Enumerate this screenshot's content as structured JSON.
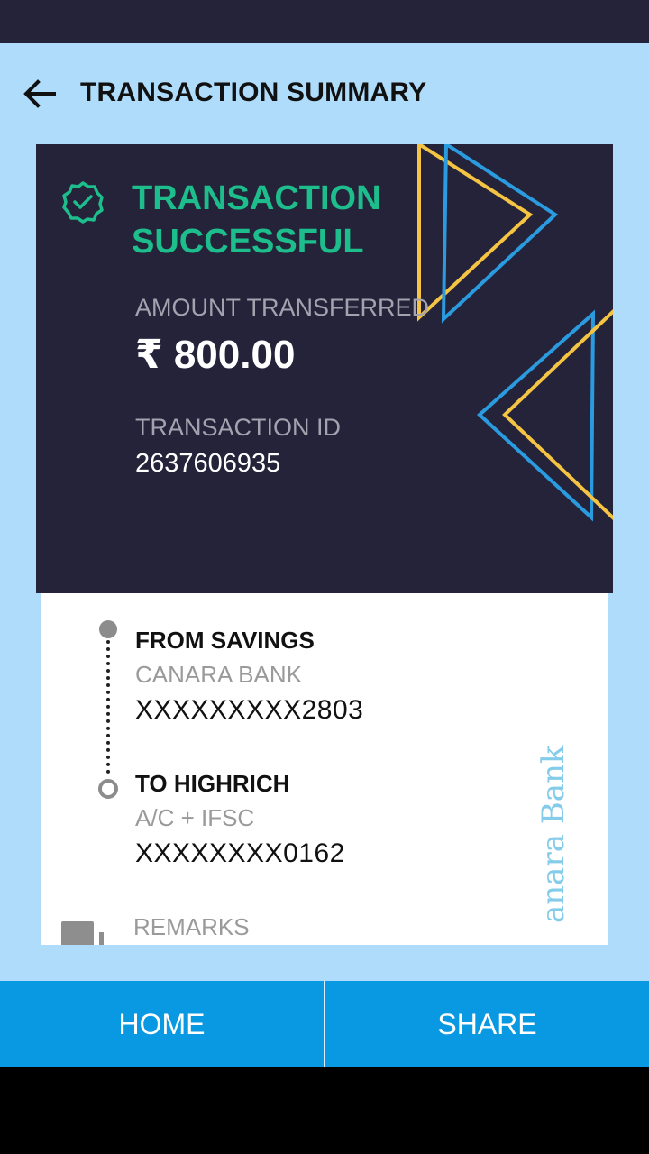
{
  "header": {
    "title": "TRANSACTION SUMMARY",
    "back_icon": "arrow-left-icon"
  },
  "summary": {
    "status_line1": "TRANSACTION",
    "status_line2": "SUCCESSFUL",
    "status_icon": "check-badge-icon",
    "amount_label": "AMOUNT TRANSFERRED",
    "amount": "₹ 800.00",
    "transaction_id_label": "TRANSACTION ID",
    "transaction_id": "2637606935"
  },
  "details": {
    "from_heading": "FROM SAVINGS",
    "from_bank": "CANARA BANK",
    "from_account": "XXXXXXXXX2803",
    "to_heading": "TO HIGHRICH",
    "to_type": "A/C + IFSC",
    "to_account": "XXXXXXXX0162",
    "remarks_label": "REMARKS",
    "watermark": "anara Bank"
  },
  "actions": {
    "home_label": "HOME",
    "share_label": "SHARE"
  },
  "colors": {
    "accent_green": "#1dbd8c",
    "card_dark": "#24233a",
    "background": "#aedcfa",
    "button_blue": "#0899e2",
    "deco_yellow": "#f5c443",
    "deco_blue": "#2b9be0"
  }
}
